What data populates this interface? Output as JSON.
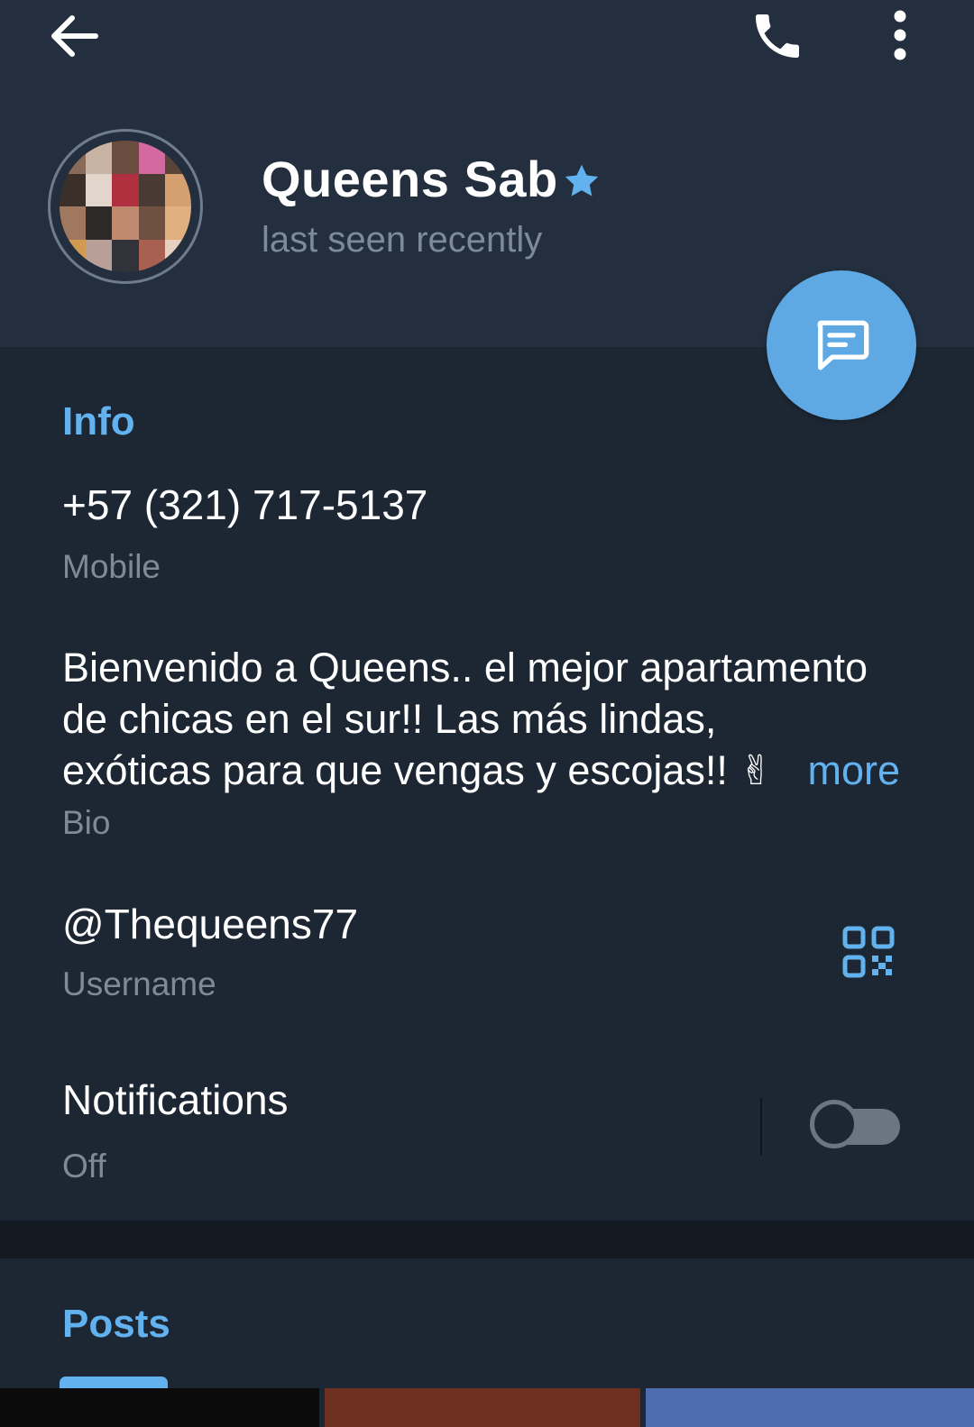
{
  "profile": {
    "name": "Queens Sab",
    "status": "last seen recently"
  },
  "info": {
    "section_title": "Info",
    "phone": "+57 (321) 717-5137",
    "phone_label": "Mobile",
    "bio_lines": [
      "Bienvenido a Queens.. el mejor apartamento",
      "de chicas en el sur!! Las más lindas,",
      "exóticas para que vengas y escojas!! ✌"
    ],
    "bio_more": "more",
    "bio_label": "Bio",
    "username": "@Thequeens77",
    "username_label": "Username",
    "notifications": "Notifications",
    "notifications_state": "Off"
  },
  "posts": {
    "section_title": "Posts"
  },
  "toggle": {
    "on": false
  },
  "colors": {
    "accent": "#62b2f0",
    "fab": "#5ea9e3",
    "background": "#1d2733",
    "header": "#232f3e",
    "secondary_text": "#7d8b99"
  },
  "icons": {
    "back": "arrow-left-icon",
    "call": "phone-icon",
    "menu": "more-vertical-icon",
    "verified": "star-icon",
    "message": "message-icon",
    "qr": "qr-code-icon"
  }
}
